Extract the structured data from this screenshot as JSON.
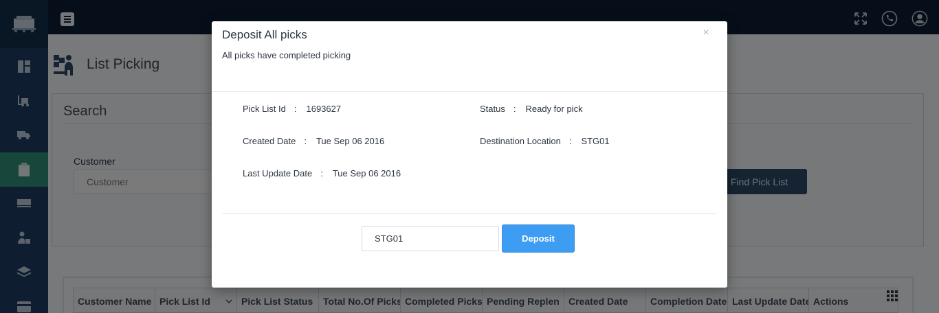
{
  "app": {
    "title": "List Picking"
  },
  "topbar": {
    "icons": [
      "menu-icon",
      "expand-icon",
      "phone-icon",
      "user-icon"
    ]
  },
  "sidebar": {
    "active_index": 3,
    "items": [
      "dashboard-icon",
      "forklift-icon",
      "truck-icon",
      "clipboard-icon",
      "dock-icon",
      "worker-icon",
      "layers-icon",
      "card-icon"
    ]
  },
  "search": {
    "title": "Search",
    "customer_label": "Customer",
    "customer_placeholder": "Customer",
    "find_button": "Find Pick List"
  },
  "table": {
    "columns": [
      "Customer Name",
      "Pick List Id",
      "Pick List Status",
      "Total No.Of Picks",
      "Completed Picks",
      "Pending Replen",
      "Created Date",
      "Completion Date",
      "Last Update Date",
      "Actions"
    ]
  },
  "modal": {
    "title": "Deposit All picks",
    "subtitle": "All picks have completed picking",
    "close": "×",
    "fields": {
      "pick_list_id_label": "Pick List Id",
      "pick_list_id_value": "1693627",
      "status_label": "Status",
      "status_value": "Ready for pick",
      "created_date_label": "Created Date",
      "created_date_value": "Tue Sep 06 2016",
      "destination_label": "Destination Location",
      "destination_value": "STG01",
      "last_update_label": "Last Update Date",
      "last_update_value": "Tue Sep 06 2016",
      "separator": ":"
    },
    "location_value": "STG01",
    "deposit_button": "Deposit"
  },
  "colors": {
    "topbar": "#0d1e33",
    "sidebar": "#1c3a5e",
    "sidebar_active": "#2f8c74",
    "deposit": "#3d9df2",
    "find": "#2b4766"
  }
}
